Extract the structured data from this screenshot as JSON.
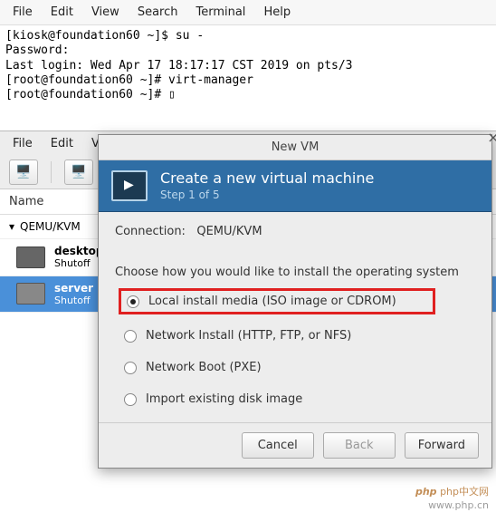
{
  "terminal_menu": {
    "file": "File",
    "edit": "Edit",
    "view": "View",
    "search": "Search",
    "terminal": "Terminal",
    "help": "Help"
  },
  "terminal": {
    "line1": "[kiosk@foundation60 ~]$ su -",
    "line2": "Password:",
    "line3": "Last login: Wed Apr 17 18:17:17 CST 2019 on pts/3",
    "line4": "[root@foundation60 ~]# virt-manager",
    "line5": "[root@foundation60 ~]# "
  },
  "vmm_menu": {
    "file": "File",
    "edit": "Edit",
    "view": "Vie"
  },
  "vmm": {
    "header": "Name",
    "group_label": "QEMU/KVM",
    "vms": [
      {
        "name": "desktop",
        "status": "Shutoff"
      },
      {
        "name": "server",
        "status": "Shutoff"
      }
    ]
  },
  "dialog": {
    "title": "New VM",
    "head_title": "Create a new virtual machine",
    "head_step": "Step 1 of 5",
    "connection_label": "Connection:",
    "connection_value": "QEMU/KVM",
    "choose_text": "Choose how you would like to install the operating system",
    "options": {
      "local": "Local install media (ISO image or CDROM)",
      "network_install": "Network Install (HTTP, FTP, or NFS)",
      "network_boot": "Network Boot (PXE)",
      "import": "Import existing disk image"
    },
    "buttons": {
      "cancel": "Cancel",
      "back": "Back",
      "forward": "Forward"
    }
  },
  "watermark": {
    "brand": "php",
    "site": "php中文网",
    "url": "www.php.cn"
  }
}
